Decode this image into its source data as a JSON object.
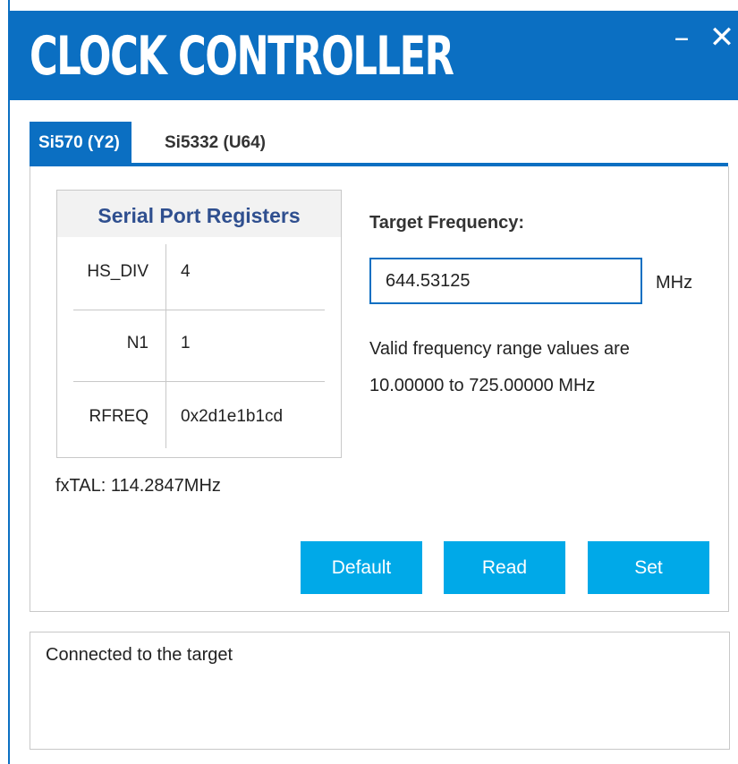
{
  "window": {
    "title": "CLOCK CONTROLLER",
    "minimize_glyph": "–",
    "close_glyph": "✕",
    "accent_color": "#0b6fc2"
  },
  "tabs": [
    {
      "label": "Si570 (Y2)",
      "active": true
    },
    {
      "label": "Si5332 (U64)",
      "active": false
    }
  ],
  "registers": {
    "header": "Serial Port Registers",
    "rows": [
      {
        "name": "HS_DIV",
        "value": "4"
      },
      {
        "name": "N1",
        "value": "1"
      },
      {
        "name": "RFREQ",
        "value": "0x2d1e1b1cd"
      }
    ]
  },
  "fxtal": "fxTAL: 114.2847MHz",
  "frequency": {
    "label": "Target Frequency:",
    "value": "644.53125",
    "unit": "MHz",
    "range_line1": "Valid frequency range values are",
    "range_line2": "10.00000 to 725.00000 MHz"
  },
  "buttons": {
    "default_label": "Default",
    "read_label": "Read",
    "set_label": "Set",
    "color": "#00a9e8"
  },
  "status": {
    "message": "Connected to the target"
  }
}
